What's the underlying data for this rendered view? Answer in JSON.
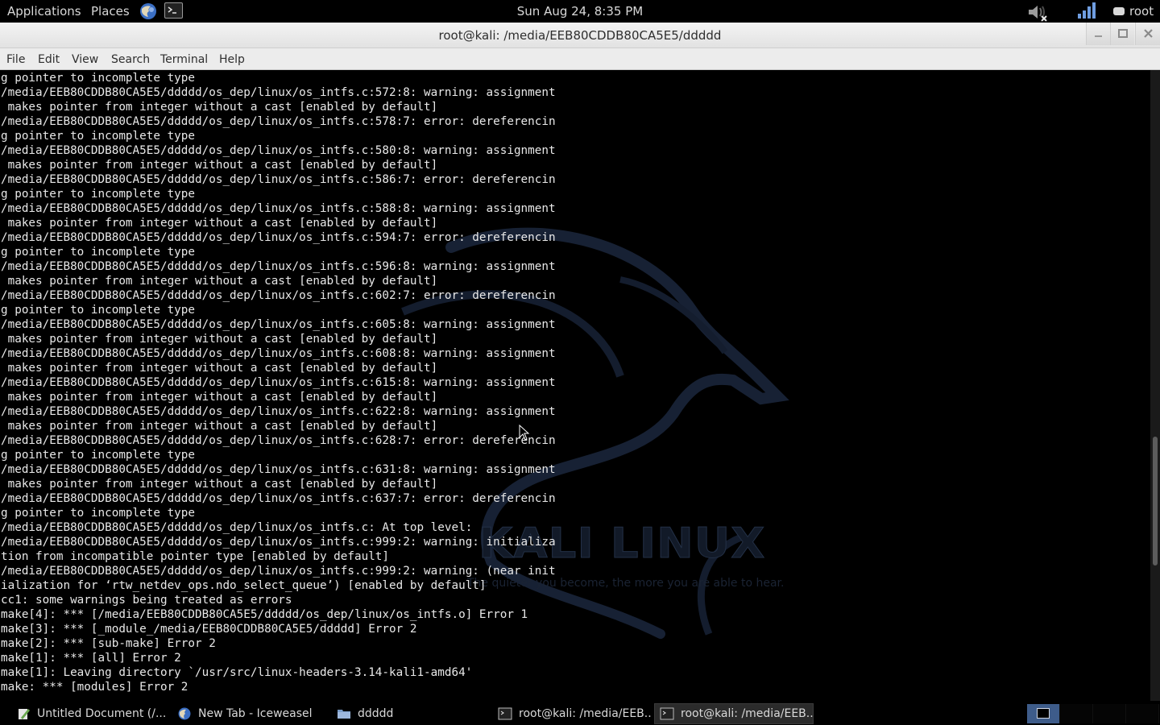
{
  "top_panel": {
    "applications": "Applications",
    "places": "Places",
    "clock": "Sun Aug 24,  8:35 PM",
    "user": "root",
    "icons": [
      "browser-icon",
      "terminal-launcher-icon",
      "volume-muted-icon",
      "network-signal-icon",
      "chat-status-icon"
    ]
  },
  "window": {
    "title": "root@kali: /media/EEB80CDDB80CA5E5/ddddd"
  },
  "menubar": {
    "file": "File",
    "edit": "Edit",
    "view": "View",
    "search": "Search",
    "terminal": "Terminal",
    "help": "Help"
  },
  "terminal": {
    "lines": [
      "g pointer to incomplete type",
      "/media/EEB80CDDB80CA5E5/ddddd/os_dep/linux/os_intfs.c:572:8: warning: assignment",
      " makes pointer from integer without a cast [enabled by default]",
      "/media/EEB80CDDB80CA5E5/ddddd/os_dep/linux/os_intfs.c:578:7: error: dereferencin",
      "g pointer to incomplete type",
      "/media/EEB80CDDB80CA5E5/ddddd/os_dep/linux/os_intfs.c:580:8: warning: assignment",
      " makes pointer from integer without a cast [enabled by default]",
      "/media/EEB80CDDB80CA5E5/ddddd/os_dep/linux/os_intfs.c:586:7: error: dereferencin",
      "g pointer to incomplete type",
      "/media/EEB80CDDB80CA5E5/ddddd/os_dep/linux/os_intfs.c:588:8: warning: assignment",
      " makes pointer from integer without a cast [enabled by default]",
      "/media/EEB80CDDB80CA5E5/ddddd/os_dep/linux/os_intfs.c:594:7: error: dereferencin",
      "g pointer to incomplete type",
      "/media/EEB80CDDB80CA5E5/ddddd/os_dep/linux/os_intfs.c:596:8: warning: assignment",
      " makes pointer from integer without a cast [enabled by default]",
      "/media/EEB80CDDB80CA5E5/ddddd/os_dep/linux/os_intfs.c:602:7: error: dereferencin",
      "g pointer to incomplete type",
      "/media/EEB80CDDB80CA5E5/ddddd/os_dep/linux/os_intfs.c:605:8: warning: assignment",
      " makes pointer from integer without a cast [enabled by default]",
      "/media/EEB80CDDB80CA5E5/ddddd/os_dep/linux/os_intfs.c:608:8: warning: assignment",
      " makes pointer from integer without a cast [enabled by default]",
      "/media/EEB80CDDB80CA5E5/ddddd/os_dep/linux/os_intfs.c:615:8: warning: assignment",
      " makes pointer from integer without a cast [enabled by default]",
      "/media/EEB80CDDB80CA5E5/ddddd/os_dep/linux/os_intfs.c:622:8: warning: assignment",
      " makes pointer from integer without a cast [enabled by default]",
      "/media/EEB80CDDB80CA5E5/ddddd/os_dep/linux/os_intfs.c:628:7: error: dereferencin",
      "g pointer to incomplete type",
      "/media/EEB80CDDB80CA5E5/ddddd/os_dep/linux/os_intfs.c:631:8: warning: assignment",
      " makes pointer from integer without a cast [enabled by default]",
      "/media/EEB80CDDB80CA5E5/ddddd/os_dep/linux/os_intfs.c:637:7: error: dereferencin",
      "g pointer to incomplete type",
      "/media/EEB80CDDB80CA5E5/ddddd/os_dep/linux/os_intfs.c: At top level:",
      "/media/EEB80CDDB80CA5E5/ddddd/os_dep/linux/os_intfs.c:999:2: warning: initializa",
      "tion from incompatible pointer type [enabled by default]",
      "/media/EEB80CDDB80CA5E5/ddddd/os_dep/linux/os_intfs.c:999:2: warning: (near init",
      "ialization for ‘rtw_netdev_ops.ndo_select_queue’) [enabled by default]",
      "cc1: some warnings being treated as errors",
      "make[4]: *** [/media/EEB80CDDB80CA5E5/ddddd/os_dep/linux/os_intfs.o] Error 1",
      "make[3]: *** [_module_/media/EEB80CDDB80CA5E5/ddddd] Error 2",
      "make[2]: *** [sub-make] Error 2",
      "make[1]: *** [all] Error 2",
      "make[1]: Leaving directory `/usr/src/linux-headers-3.14-kali1-amd64'",
      "make: *** [modules] Error 2"
    ],
    "watermark_title": "KALI LINUX",
    "watermark_tagline": "The quieter you become, the more you are able to hear.",
    "colors": {
      "background": "#000000",
      "text": "#e8e8e8"
    }
  },
  "taskbar": {
    "tasks": [
      {
        "label": "Untitled Document (/...",
        "icon": "text-editor-icon"
      },
      {
        "label": "New Tab - Iceweasel",
        "icon": "iceweasel-icon"
      },
      {
        "label": "ddddd",
        "icon": "folder-icon"
      },
      {
        "label": "root@kali: /media/EEB...",
        "icon": "terminal-icon"
      },
      {
        "label": "root@kali: /media/EEB...",
        "icon": "terminal-icon"
      }
    ],
    "workspace_count": 4,
    "current_workspace": 1
  }
}
